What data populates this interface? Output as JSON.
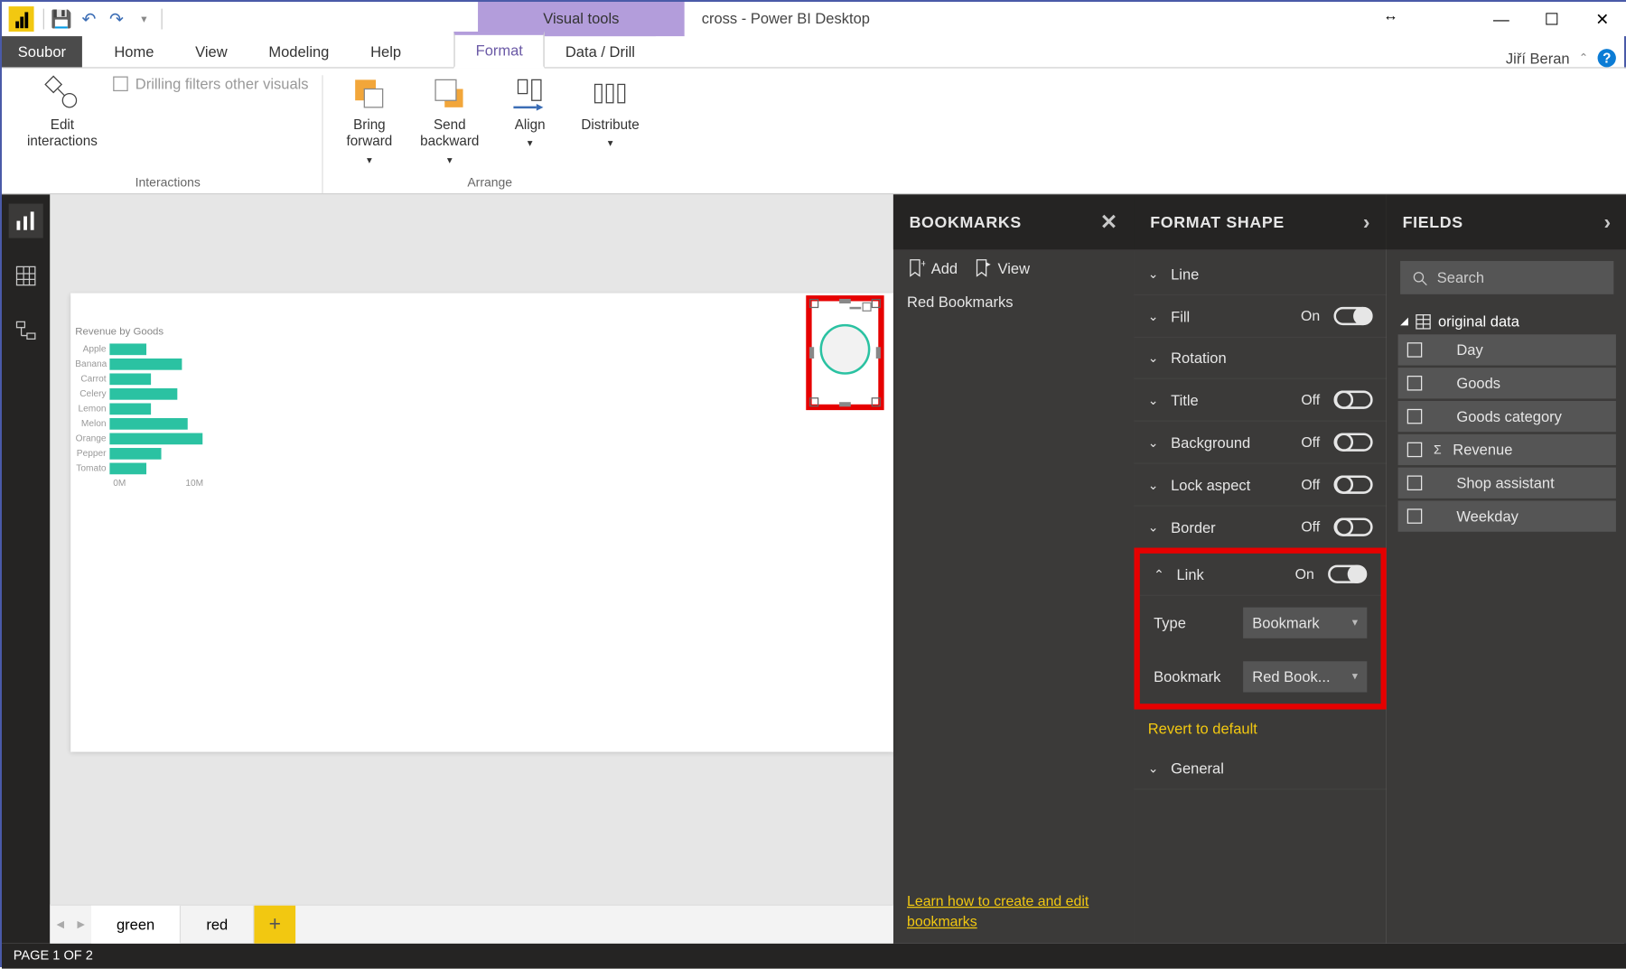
{
  "title": "cross - Power BI Desktop",
  "context_tab": "Visual tools",
  "user": "Jiří Beran",
  "menu": {
    "file": "Soubor",
    "tabs": [
      "Home",
      "View",
      "Modeling",
      "Help"
    ],
    "context": [
      "Format",
      "Data / Drill"
    ],
    "active": "Format"
  },
  "ribbon": {
    "interactions": {
      "label": "Interactions",
      "edit": "Edit\ninteractions",
      "drilling": "Drilling filters other visuals"
    },
    "arrange": {
      "label": "Arrange",
      "bring": "Bring\nforward",
      "send": "Send\nbackward",
      "align": "Align",
      "distribute": "Distribute"
    }
  },
  "page_tabs": {
    "green": "green",
    "red": "red"
  },
  "chart_data": {
    "type": "bar",
    "title": "Revenue by Goods",
    "categories": [
      "Apple",
      "Banana",
      "Carrot",
      "Celery",
      "Lemon",
      "Melon",
      "Orange",
      "Pepper",
      "Tomato"
    ],
    "values": [
      3.5,
      7.0,
      4.0,
      6.5,
      4.0,
      7.5,
      9.0,
      5.0,
      3.5
    ],
    "xticks": [
      "0M",
      "10M"
    ],
    "xlim": [
      0,
      10
    ],
    "xlabel": "",
    "ylabel": ""
  },
  "bookmarks": {
    "title": "BOOKMARKS",
    "add": "Add",
    "view": "View",
    "items": [
      "Red Bookmarks"
    ],
    "learn": "Learn how to create and edit bookmarks"
  },
  "format": {
    "title": "FORMAT SHAPE",
    "rows": {
      "line": "Line",
      "fill": "Fill",
      "fill_state": "On",
      "rotation": "Rotation",
      "title_l": "Title",
      "title_state": "Off",
      "background": "Background",
      "background_state": "Off",
      "lock": "Lock aspect",
      "lock_state": "Off",
      "border": "Border",
      "border_state": "Off",
      "link": "Link",
      "link_state": "On",
      "type_l": "Type",
      "type_v": "Bookmark",
      "bookmark_l": "Bookmark",
      "bookmark_v": "Red Book...",
      "revert": "Revert to default",
      "general": "General"
    }
  },
  "fields": {
    "title": "FIELDS",
    "search": "Search",
    "group": "original data",
    "items": [
      "Day",
      "Goods",
      "Goods category",
      "Revenue",
      "Shop assistant",
      "Weekday"
    ]
  },
  "status": "PAGE 1 OF 2"
}
